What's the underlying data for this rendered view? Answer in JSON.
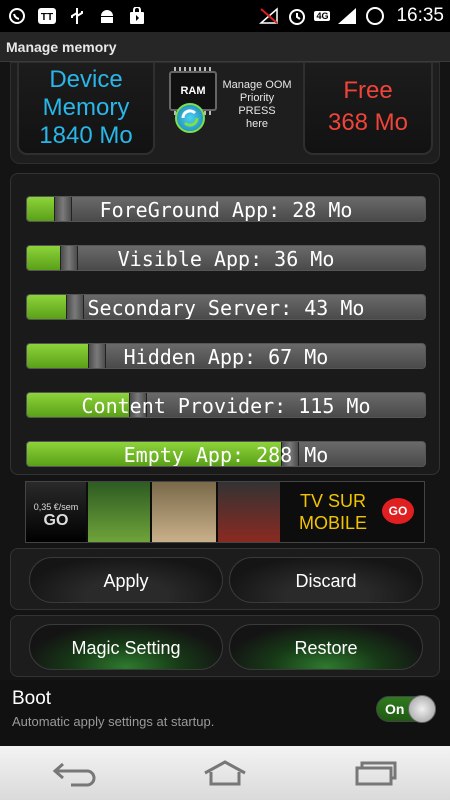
{
  "status_bar": {
    "time": "16:35",
    "network_type": "4G",
    "icons": [
      "whatsapp-icon",
      "tt-icon",
      "usb-icon",
      "android-icon",
      "shopping-bag-icon",
      "no-signal-icon",
      "alarm-icon",
      "signal-icon",
      "battery-icon"
    ]
  },
  "title": "Manage memory",
  "memory": {
    "device_label": "Device",
    "device_sublabel": "Memory",
    "device_value": "1840 Mo",
    "free_label": "Free",
    "free_value": "368 Mo",
    "chip_label": "RAM",
    "oom_text_1": "Manage OOM",
    "oom_text_2": "Priority",
    "oom_text_3": "PRESS",
    "oom_text_4": "here"
  },
  "sliders": [
    {
      "label": "ForeGround App: 28 Mo",
      "value_mb": 28,
      "fill_fraction": 0.09
    },
    {
      "label": "Visible App: 36 Mo",
      "value_mb": 36,
      "fill_fraction": 0.105
    },
    {
      "label": "Secondary Server: 43 Mo",
      "value_mb": 43,
      "fill_fraction": 0.12
    },
    {
      "label": "Hidden App: 67 Mo",
      "value_mb": 67,
      "fill_fraction": 0.175
    },
    {
      "label": "Content Provider: 115 Mo",
      "value_mb": 115,
      "fill_fraction": 0.28
    },
    {
      "label": "Empty App: 288 Mo",
      "value_mb": 288,
      "fill_fraction": 0.66
    }
  ],
  "ad": {
    "price": "0,35 €/sem",
    "brand": "GO",
    "headline_1": "TV SUR",
    "headline_2": "MOBILE",
    "go_badge": "GO"
  },
  "buttons": {
    "apply": "Apply",
    "discard": "Discard",
    "magic": "Magic Setting",
    "restore": "Restore"
  },
  "boot": {
    "title": "Boot",
    "subtitle": "Automatic apply settings at startup.",
    "toggle_label": "On",
    "toggle_state": true
  },
  "colors": {
    "device_memory": "#29b6e8",
    "free_memory": "#f0443a",
    "slider_fill": "#7cc42e"
  }
}
